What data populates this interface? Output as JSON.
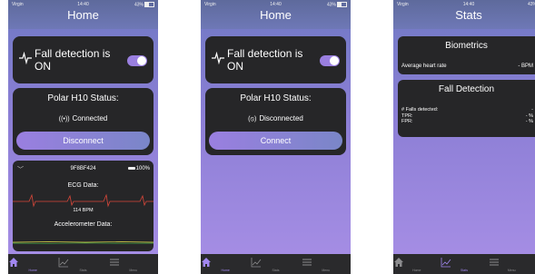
{
  "status_bar": {
    "carrier": "Virgin",
    "time": "14:40",
    "battery": "43%"
  },
  "home": {
    "title": "Home",
    "fall_detection": {
      "label": "Fall detection is ON"
    },
    "status_title": "Polar H10 Status:",
    "connection_connected": "Connected",
    "connection_disconnected": "Disconnected",
    "disconnect_label": "Disconnect",
    "connect_label": "Connect",
    "ecg": {
      "device_id": "9F8BF424",
      "battery": "100%",
      "ecg_title": "ECG Data:",
      "bpm": "114 BPM",
      "acc_title": "Accelerometer Data:"
    }
  },
  "stats": {
    "title": "Stats",
    "biometrics_title": "Biometrics",
    "avg_hr_label": "Average heart rate",
    "avg_hr_value": "- BPM",
    "fall_title": "Fall Detection",
    "falls_label": "# Falls detected:",
    "falls_value": "-",
    "tpr_label": "TPR:",
    "tpr_value": "- %",
    "fpr_label": "FPR:",
    "fpr_value": "- %"
  },
  "tabs": [
    {
      "label": "Home",
      "icon": "home-icon"
    },
    {
      "label": "Stats",
      "icon": "chart-icon"
    },
    {
      "label": "Menu",
      "icon": "menu-icon"
    }
  ],
  "colors": {
    "accent": "#a287f0",
    "card": "#262628",
    "ecg_line": "#d9473a"
  }
}
